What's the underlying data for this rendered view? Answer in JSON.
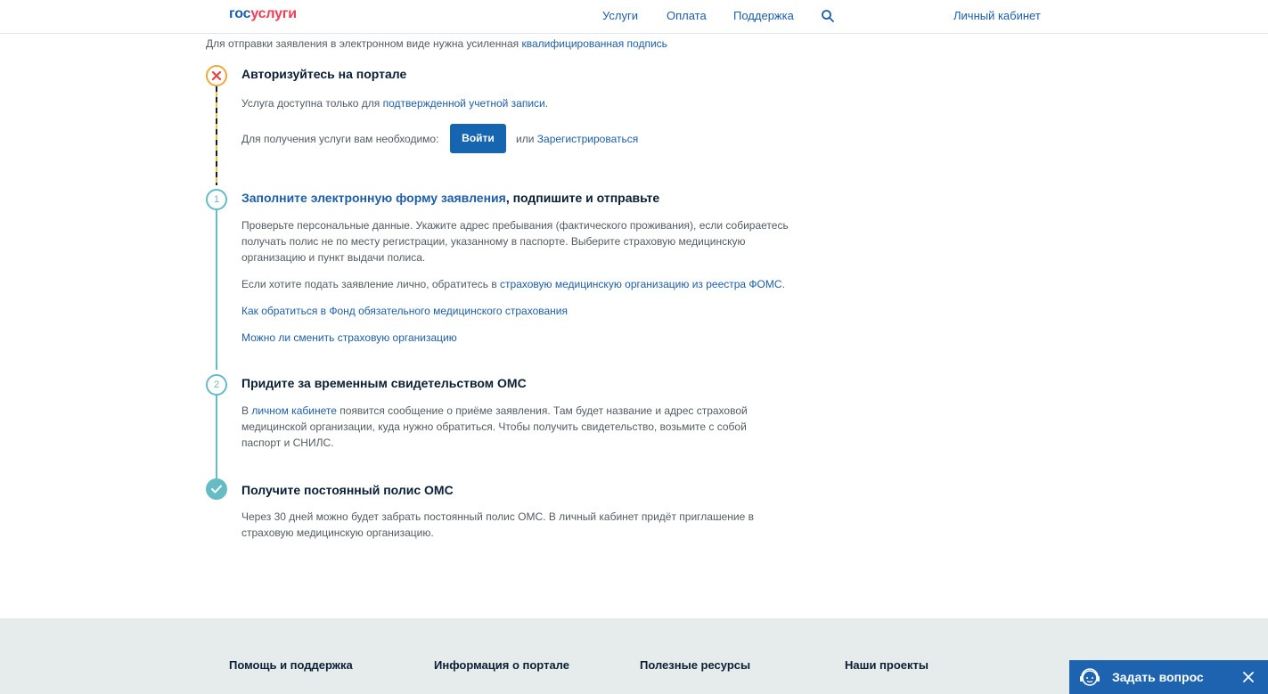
{
  "header": {
    "logo_part1": "гос",
    "logo_part2": "услуги",
    "nav": [
      "Услуги",
      "Оплата",
      "Поддержка"
    ],
    "cabinet": "Личный кабинет"
  },
  "intro": {
    "text": "Для отправки заявления в электронном виде нужна усиленная ",
    "link": "квалифицированная подпись"
  },
  "step0": {
    "title": "Авторизуйтесь на портале",
    "p1_text": "Услуга доступна только для ",
    "p1_link": "подтвержденной учетной записи.",
    "p2_text": "Для получения услуги вам необходимо:",
    "login_button": "Войти",
    "or": "или",
    "register_link": "Зарегистрироваться"
  },
  "step1": {
    "number": "1",
    "title_link": "Заполните электронную форму заявления",
    "title_rest": ", подпишите и отправьте",
    "p1": "Проверьте персональные данные. Укажите адрес пребывания (фактического проживания), если собираетесь получать полис не по месту регистрации, указанному в паспорте. Выберите страховую медицинскую организацию и пункт выдачи полиса.",
    "p2_text": "Если хотите подать заявление лично, обратитесь в ",
    "p2_link": "страховую медицинскую организацию из реестра ФОМС",
    "p2_end": ".",
    "link1": "Как обратиться в Фонд обязательного медицинского страхования",
    "link2": "Можно ли сменить страховую организацию"
  },
  "step2": {
    "number": "2",
    "title": "Придите за временным свидетельством ОМС",
    "p1_start": "В ",
    "p1_link": "личном кабинете",
    "p1_rest": " появится сообщение о приёме заявления. Там будет название и адрес страховой медицинской организации, куда нужно обратиться. Чтобы получить свидетельство, возьмите с собой паспорт и СНИЛС."
  },
  "step3": {
    "title": "Получите постоянный полис ОМС",
    "p1": "Через 30 дней можно будет забрать постоянный полис ОМС. В личный кабинет придёт приглашение в страховую медицинскую организацию."
  },
  "footer": {
    "columns": [
      "Помощь и поддержка",
      "Информация о портале",
      "Полезные ресурсы",
      "Наши проекты"
    ]
  },
  "ask": {
    "label": "Задать вопрос"
  },
  "colors": {
    "link": "#1e5da8",
    "accent_teal": "#65bcc3",
    "warning_orange": "#f0a83b",
    "error_red": "#e8423f",
    "button_blue": "#1565b0"
  }
}
